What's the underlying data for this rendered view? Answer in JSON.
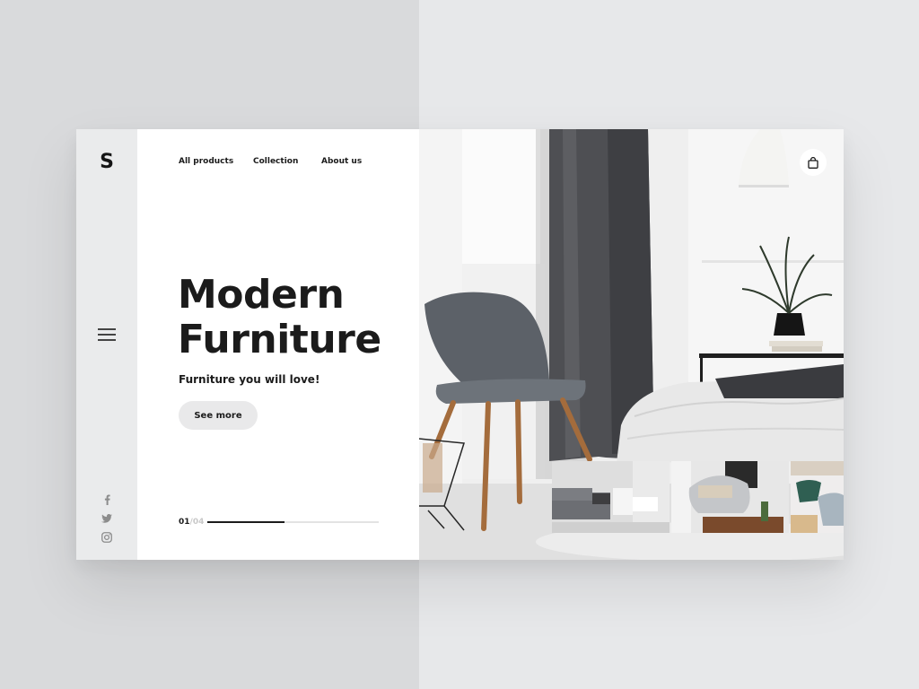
{
  "brand": {
    "logo": "S"
  },
  "nav": [
    {
      "label": "All products"
    },
    {
      "label": "Collection"
    },
    {
      "label": "About us"
    }
  ],
  "hero": {
    "title_line1": "Modern",
    "title_line2": "Furniture",
    "tagline": "Furniture you will love!",
    "cta_label": "See more"
  },
  "slider": {
    "current": "01",
    "separator": "/",
    "total": "04",
    "progress": 0.45
  },
  "social": [
    {
      "icon": "facebook-icon"
    },
    {
      "icon": "twitter-icon"
    },
    {
      "icon": "instagram-icon"
    }
  ],
  "icons": {
    "menu": "hamburger-menu-icon",
    "cart": "shopping-bag-icon"
  },
  "colors": {
    "text": "#1b1b1b",
    "sidebar": "#eaebec",
    "button": "#e9e9ea",
    "progress_fill": "#1b1b1b",
    "progress_track": "#e3e3e3"
  }
}
